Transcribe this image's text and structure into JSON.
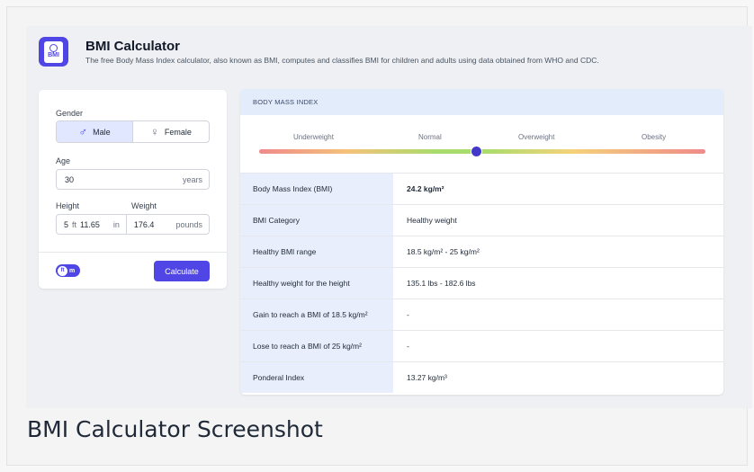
{
  "app": {
    "icon_text": "BMI",
    "title": "BMI Calculator",
    "subtitle": "The free Body Mass Index calculator, also known as BMI, computes and classifies BMI for children and adults using data obtained from WHO and CDC."
  },
  "form": {
    "gender_label": "Gender",
    "male_label": "Male",
    "female_label": "Female",
    "selected_gender": "Male",
    "age_label": "Age",
    "age_value": "30",
    "age_unit": "years",
    "height_label": "Height",
    "height_feet": "5",
    "height_feet_unit": "ft",
    "height_inches": "11.65",
    "height_inches_unit": "in",
    "weight_label": "Weight",
    "weight_value": "176.4",
    "weight_unit": "pounds",
    "unit_toggle_active": "ft",
    "unit_toggle_other": "m",
    "calculate_label": "Calculate"
  },
  "result": {
    "header": "BODY MASS INDEX",
    "categories": [
      "Underweight",
      "Normal",
      "Overweight",
      "Obesity"
    ],
    "marker_position": 0.485,
    "colors": {
      "accent": "#4f46e5",
      "marker": "#4338ca"
    },
    "rows": [
      {
        "key": "Body Mass Index (BMI)",
        "value": "24.2 kg/m²"
      },
      {
        "key": "BMI Category",
        "value": "Healthy weight"
      },
      {
        "key": "Healthy BMI range",
        "value": "18.5 kg/m² - 25 kg/m²"
      },
      {
        "key": "Healthy weight for the height",
        "value": "135.1 lbs - 182.6 lbs"
      },
      {
        "key": "Gain to reach a BMI of 18.5 kg/m²",
        "value": "-"
      },
      {
        "key": "Lose to reach a BMI of 25 kg/m²",
        "value": "-"
      },
      {
        "key": "Ponderal Index",
        "value": "13.27 kg/m³"
      }
    ]
  },
  "caption": "BMI Calculator Screenshot"
}
